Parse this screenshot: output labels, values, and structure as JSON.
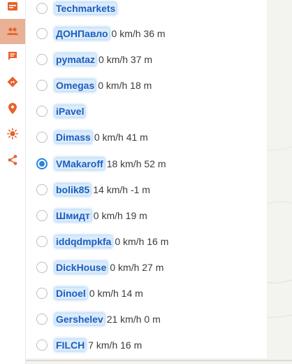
{
  "colors": {
    "accent": "#e7622b",
    "selected_radio": "#2a84e0",
    "active_tab_bg": "#e9b196"
  },
  "sidebar": {
    "items": [
      {
        "icon": "card-icon"
      },
      {
        "icon": "people-icon",
        "active": true
      },
      {
        "icon": "chat-icon"
      },
      {
        "icon": "directions-icon"
      },
      {
        "icon": "pin-icon"
      },
      {
        "icon": "sun-icon"
      },
      {
        "icon": "share-icon"
      }
    ]
  },
  "users": [
    {
      "name": "Techmarkets",
      "status": "",
      "selected": false
    },
    {
      "name": "ДОНПавло",
      "status": "0 km/h 36 m",
      "selected": false
    },
    {
      "name": "pymataz",
      "status": "0 km/h 37 m",
      "selected": false
    },
    {
      "name": "Omegas",
      "status": "0 km/h 18 m",
      "selected": false
    },
    {
      "name": "iPavel",
      "status": "",
      "selected": false
    },
    {
      "name": "Dimass",
      "status": "0 km/h 41 m",
      "selected": false
    },
    {
      "name": "VMakaroff",
      "status": "18 km/h 52 m",
      "selected": true
    },
    {
      "name": "bolik85",
      "status": "14 km/h -1 m",
      "selected": false
    },
    {
      "name": "Шмидт",
      "status": "0 km/h 19 m",
      "selected": false
    },
    {
      "name": "iddqdmpkfa",
      "status": "0 km/h 16 m",
      "selected": false
    },
    {
      "name": "DickHouse",
      "status": "0 km/h 27 m",
      "selected": false
    },
    {
      "name": "Dinoel",
      "status": "0 km/h 14 m",
      "selected": false
    },
    {
      "name": "Gershelev",
      "status": "21 km/h 0 m",
      "selected": false
    },
    {
      "name": "FILCH",
      "status": "7 km/h 16 m",
      "selected": false
    }
  ]
}
